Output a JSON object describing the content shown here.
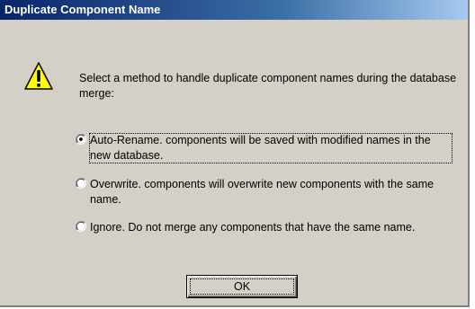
{
  "dialog": {
    "title": "Duplicate Component Name",
    "icon": "warning-icon",
    "message": "Select a method to handle duplicate component names during the database merge:",
    "options": [
      {
        "label": "Auto-Rename. components will be saved with modified names in the new database.",
        "selected": true
      },
      {
        "label": "Overwrite. components will overwrite new components with the same name.",
        "selected": false
      },
      {
        "label": "Ignore. Do not merge any components that have the same name.",
        "selected": false
      }
    ],
    "ok_label": "OK"
  },
  "colors": {
    "face": "#d4d0c8",
    "title_start": "#0a246a",
    "title_end": "#a6caf0",
    "warning": "#ffff00"
  }
}
